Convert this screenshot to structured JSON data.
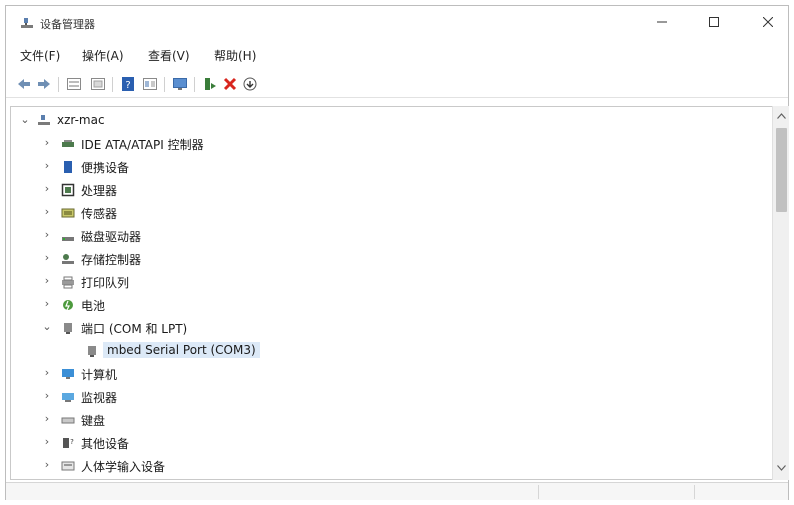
{
  "window": {
    "title": "设备管理器",
    "minimize_icon": "minimize-icon",
    "maximize_icon": "maximize-icon",
    "close_icon": "close-icon"
  },
  "menubar": {
    "items": [
      "文件(F)",
      "操作(A)",
      "查看(V)",
      "帮助(H)"
    ]
  },
  "toolbar": {
    "icons": [
      "back-arrow-icon",
      "forward-arrow-icon",
      "properties-icon",
      "view-icon",
      "help-icon",
      "list-icon",
      "monitor-icon",
      "update-driver-icon",
      "uninstall-icon",
      "scan-icon"
    ]
  },
  "tree": {
    "root": "xzr-mac",
    "items": [
      {
        "label": "IDE ATA/ATAPI 控制器",
        "expanded": false
      },
      {
        "label": "便携设备",
        "expanded": false
      },
      {
        "label": "处理器",
        "expanded": false
      },
      {
        "label": "传感器",
        "expanded": false
      },
      {
        "label": "磁盘驱动器",
        "expanded": false
      },
      {
        "label": "存储控制器",
        "expanded": false
      },
      {
        "label": "打印队列",
        "expanded": false
      },
      {
        "label": "电池",
        "expanded": false
      },
      {
        "label": "端口 (COM 和 LPT)",
        "expanded": true
      },
      {
        "label": "mbed Serial Port (COM3)",
        "child": true,
        "selected": true
      },
      {
        "label": "计算机",
        "expanded": false
      },
      {
        "label": "监视器",
        "expanded": false
      },
      {
        "label": "键盘",
        "expanded": false
      },
      {
        "label": "其他设备",
        "expanded": false
      },
      {
        "label": "人体学输入设备",
        "expanded": false
      }
    ]
  },
  "colors": {
    "selection": "#dce9f7",
    "close_red": "#d8261e",
    "help_blue": "#2a5fb0"
  }
}
